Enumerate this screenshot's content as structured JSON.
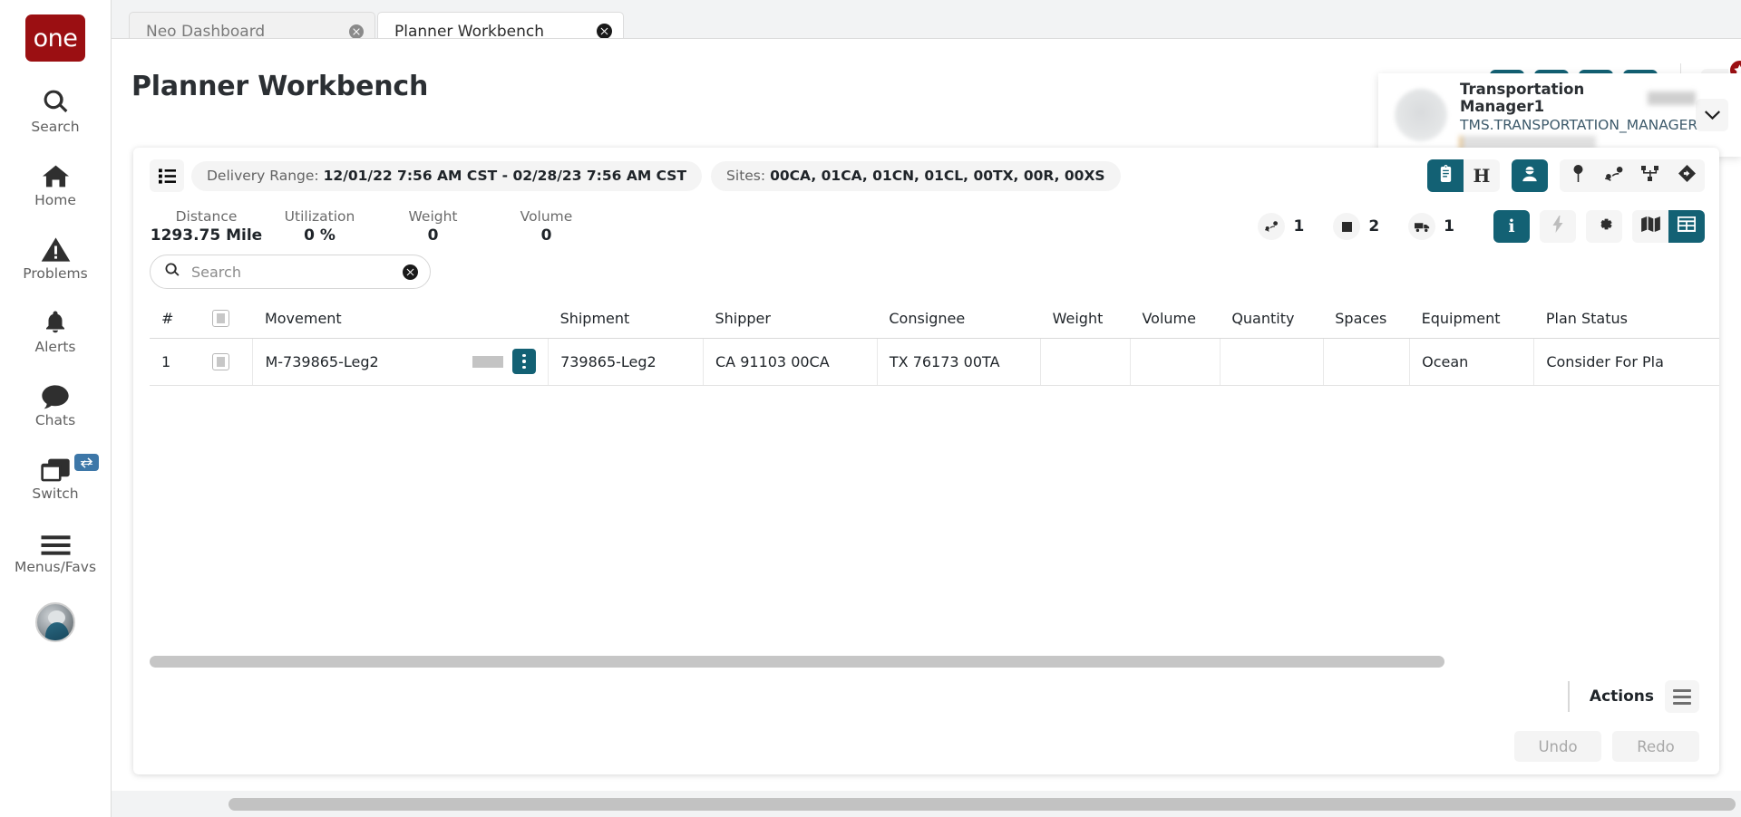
{
  "brand": {
    "logo_text": "one"
  },
  "sidebar": {
    "items": [
      {
        "label": "Search",
        "icon": "search-icon"
      },
      {
        "label": "Home",
        "icon": "home-icon"
      },
      {
        "label": "Problems",
        "icon": "warning-triangle-icon"
      },
      {
        "label": "Alerts",
        "icon": "bell-icon"
      },
      {
        "label": "Chats",
        "icon": "chat-bubble-icon"
      },
      {
        "label": "Switch",
        "icon": "windows-stack-icon",
        "badge_icon": "swap-arrows-icon"
      },
      {
        "label": "Menus/Favs",
        "icon": "hamburger-icon"
      }
    ],
    "avatar": "user-avatar-photo"
  },
  "tabs": [
    {
      "label": "Neo Dashboard",
      "active": false,
      "close_icon": "close-circle-icon"
    },
    {
      "label": "Planner Workbench",
      "active": true,
      "close_icon": "close-circle-icon"
    }
  ],
  "header": {
    "title": "Planner Workbench",
    "actions": [
      {
        "name": "info-button",
        "icon": "info-icon",
        "glyph": "i"
      },
      {
        "name": "favorite-button",
        "icon": "star-icon"
      },
      {
        "name": "refresh-button",
        "icon": "refresh-icon"
      },
      {
        "name": "close-button",
        "icon": "x-icon",
        "glyph": "x"
      }
    ],
    "menus_toggle": {
      "name": "menus-favs-toggle",
      "icon": "hamburger-icon",
      "badge_icon": "star-icon"
    }
  },
  "user": {
    "name": "Transportation Manager1",
    "role": "TMS.TRANSPORTATION_MANAGER",
    "chevron_icon": "chevron-down-icon"
  },
  "filter_bar": {
    "list_button_icon": "list-icon",
    "pills": [
      {
        "key": "Delivery Range:",
        "value": "12/01/22 7:56 AM CST - 02/28/23 7:56 AM CST"
      },
      {
        "key": "Sites:",
        "value": "00CA, 01CA, 01CN, 01CL, 00TX, 00R, 00XS"
      }
    ],
    "segments": [
      {
        "name": "clipboard-view-toggle",
        "icon": "clipboard-icon",
        "active": true
      },
      {
        "name": "history-view-toggle",
        "icon": "letter-h-icon",
        "glyph": "H",
        "active": false
      }
    ],
    "planner_button": {
      "name": "planner-persona-button",
      "icon": "planner-person-icon",
      "active": true
    },
    "map_tools": [
      {
        "name": "map-pin-tool",
        "icon": "map-pin-icon"
      },
      {
        "name": "route-tool",
        "icon": "route-icon"
      },
      {
        "name": "network-tool",
        "icon": "network-icon"
      },
      {
        "name": "direction-tool",
        "icon": "diamond-arrow-icon"
      }
    ]
  },
  "stats": [
    {
      "label": "Distance",
      "value": "1293.75 Mile"
    },
    {
      "label": "Utilization",
      "value": "0 %"
    },
    {
      "label": "Weight",
      "value": "0"
    },
    {
      "label": "Volume",
      "value": "0"
    }
  ],
  "counts": [
    {
      "name": "route-count",
      "icon": "route-icon",
      "value": "1"
    },
    {
      "name": "stop-count",
      "icon": "square-icon",
      "value": "2"
    },
    {
      "name": "truck-count",
      "icon": "truck-icon",
      "value": "1"
    }
  ],
  "view_tools": [
    {
      "name": "info-panel-button",
      "icon": "info-icon",
      "glyph": "i",
      "active": true
    },
    {
      "name": "optimize-button",
      "icon": "lightning-bolt-icon",
      "muted": true
    },
    {
      "name": "settings-button",
      "icon": "gear-icon"
    },
    {
      "name": "map-view-button",
      "icon": "map-icon",
      "active": false
    },
    {
      "name": "grid-view-button",
      "icon": "grid-table-icon",
      "active": true
    }
  ],
  "search": {
    "placeholder": "Search",
    "value": "",
    "icon": "search-icon",
    "clear_icon": "close-circle-icon"
  },
  "table": {
    "columns": [
      "#",
      "",
      "Movement",
      "Shipment",
      "Shipper",
      "Consignee",
      "Weight",
      "Volume",
      "Quantity",
      "Spaces",
      "Equipment",
      "Plan Status"
    ],
    "rows": [
      {
        "index": "1",
        "movement": "M-739865-Leg2",
        "shipment": "739865-Leg2",
        "shipper": "CA 91103 00CA",
        "consignee": "TX 76173 00TA",
        "weight": "",
        "volume": "",
        "quantity": "",
        "spaces": "",
        "equipment": "Ocean",
        "plan_status": "Consider For Pla"
      }
    ]
  },
  "footer": {
    "actions_label": "Actions",
    "actions_menu_icon": "hamburger-icon",
    "undo_label": "Undo",
    "redo_label": "Redo"
  },
  "colors": {
    "accent_teal": "#136174",
    "brand_red": "#9b0f12",
    "badge_red": "#9b0f12",
    "text_dark": "#1f2429",
    "text_muted": "#6b6b6b"
  }
}
